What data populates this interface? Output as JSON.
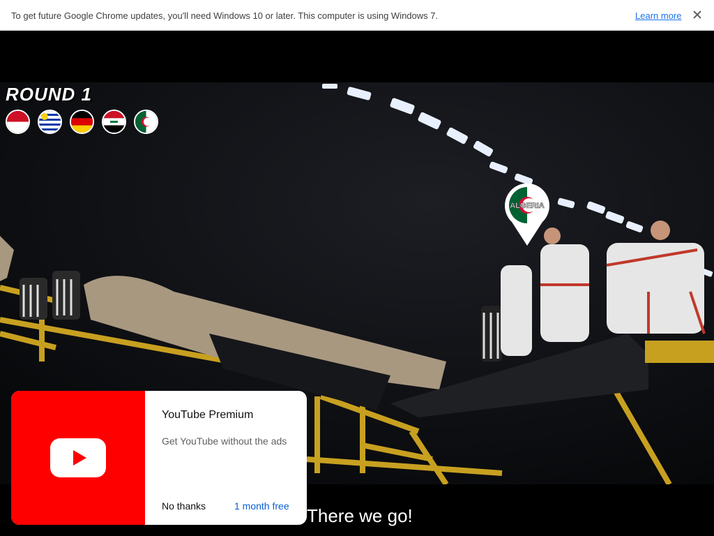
{
  "infobar": {
    "message": "To get future Google Chrome updates, you'll need Windows 10 or later. This computer is using Windows 7.",
    "link_label": "Learn more",
    "close_icon": "close-icon"
  },
  "video": {
    "round_label": "ROUND 1",
    "flags": [
      "indonesia-flag",
      "uruguay-flag",
      "germany-flag",
      "iraq-flag",
      "algeria-flag"
    ],
    "pin_label": "ALGERIA",
    "subtitle": "There we go!"
  },
  "promo": {
    "title": "YouTube Premium",
    "description": "Get YouTube without the ads",
    "dismiss_label": "No thanks",
    "cta_label": "1 month free",
    "logo_icon": "youtube-logo-icon",
    "colors": {
      "brand": "#ff0000",
      "link": "#065fd4"
    }
  }
}
